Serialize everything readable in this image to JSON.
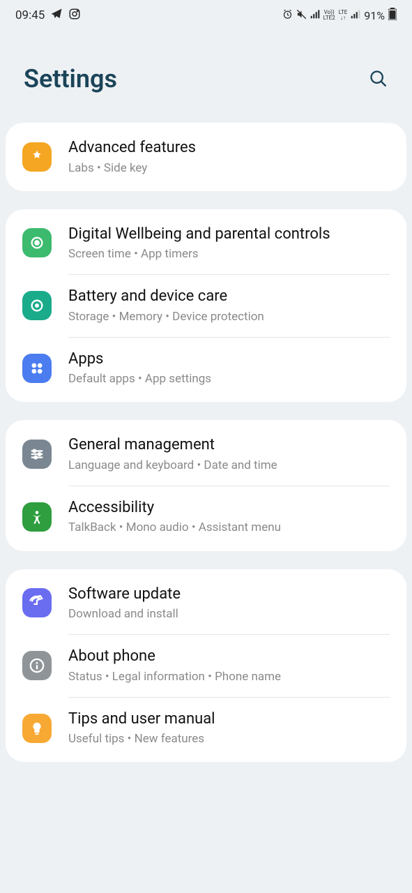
{
  "status": {
    "time": "09:45",
    "battery": "91%"
  },
  "header": {
    "title": "Settings"
  },
  "groups": [
    {
      "items": [
        {
          "title": "Advanced features",
          "sub": "Labs  •  Side key"
        }
      ]
    },
    {
      "items": [
        {
          "title": "Digital Wellbeing and parental controls",
          "sub": "Screen time  •  App timers"
        },
        {
          "title": "Battery and device care",
          "sub": "Storage  •  Memory  •  Device protection"
        },
        {
          "title": "Apps",
          "sub": "Default apps  •  App settings"
        }
      ]
    },
    {
      "items": [
        {
          "title": "General management",
          "sub": "Language and keyboard  •  Date and time"
        },
        {
          "title": "Accessibility",
          "sub": "TalkBack  •  Mono audio  •  Assistant menu"
        }
      ]
    },
    {
      "items": [
        {
          "title": "Software update",
          "sub": "Download and install"
        },
        {
          "title": "About phone",
          "sub": "Status  •  Legal information  •  Phone name"
        },
        {
          "title": "Tips and user manual",
          "sub": "Useful tips  •  New features"
        }
      ]
    }
  ]
}
